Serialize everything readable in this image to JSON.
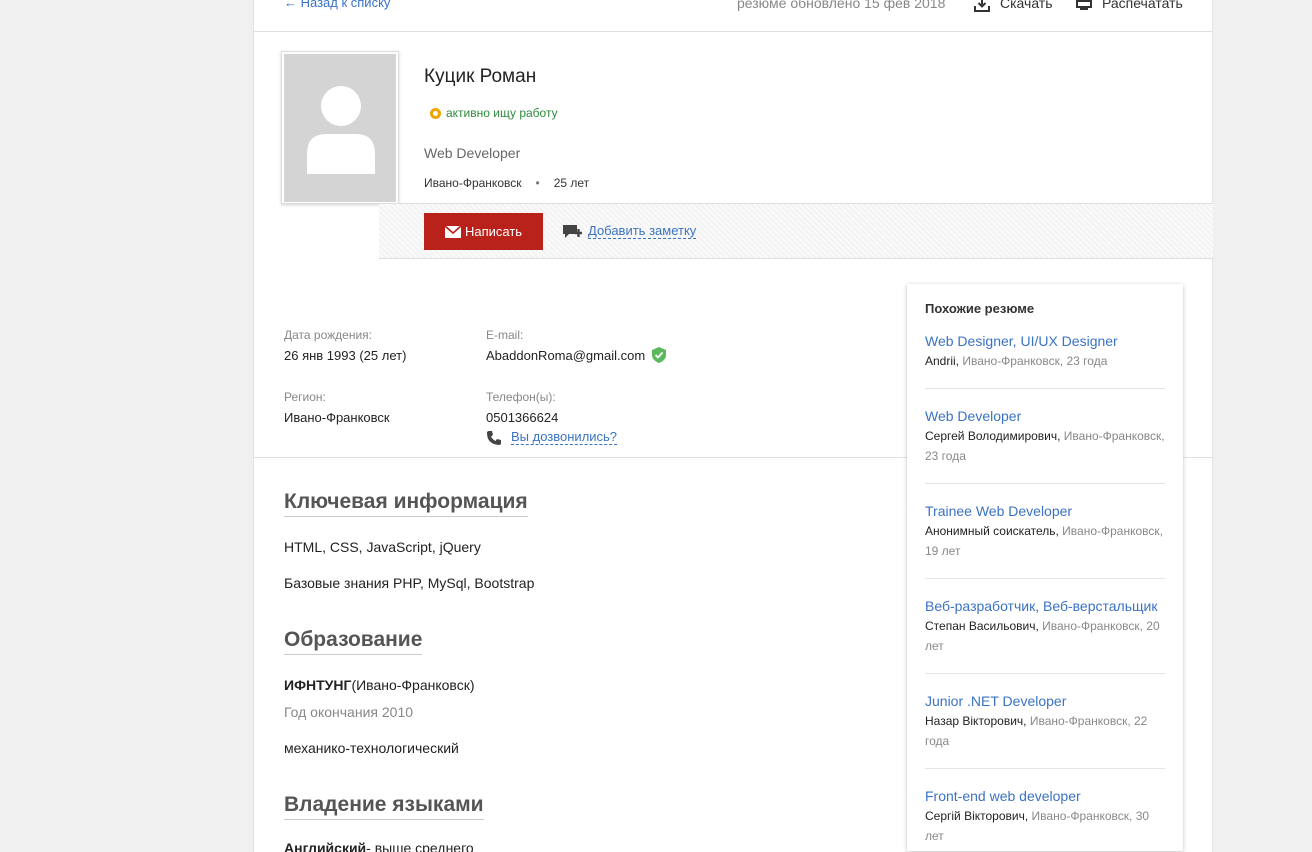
{
  "topbar": {
    "back_label": "← Назад к списку",
    "updated": "резюме обновлено 15 фев 2018",
    "download_label": "Скачать",
    "print_label": "Распечатать"
  },
  "profile": {
    "name": "Куцик Роман",
    "status": "активно ищу работу",
    "position": "Web Developer",
    "city": "Ивано-Франковск",
    "separator": "•",
    "age": "25 лет"
  },
  "actions": {
    "write_label": "Написать",
    "note_label": "Добавить заметку"
  },
  "contacts": {
    "birth_label": "Дата рождения:",
    "birth_value": "26 янв 1993 (25 лет)",
    "region_label": "Регион:",
    "region_value": "Ивано-Франковск",
    "email_label": "E-mail:",
    "email_value": "AbaddonRoma@gmail.com",
    "phone_label": "Телефон(ы):",
    "phone_value": "0501366624",
    "called_label": "Вы дозвонились?"
  },
  "key_info": {
    "title": "Ключевая информация",
    "lines": [
      "HTML, CSS, JavaScript, jQuery",
      "Базовые знания PHP, MySql, Bootstrap"
    ]
  },
  "education": {
    "title": "Образование",
    "school": "ИФНТУНГ",
    "school_city": "(Ивано-Франковск)",
    "year": "Год окончания 2010",
    "faculty": "механико-технологический"
  },
  "languages": {
    "title": "Владение языками",
    "lang": "Английский",
    "level": "- выше среднего"
  },
  "similar": {
    "title": "Похожие резюме",
    "items": [
      {
        "title": "Web Designer, UI/UX Designer",
        "person": "Andrii,",
        "details": " Ивано-Франковск, 23 года"
      },
      {
        "title": "Web Developer",
        "person": "Сергей Володимирович,",
        "details": " Ивано-Франковск, 23 года"
      },
      {
        "title": "Trainee Web Developer",
        "person": "Анонимный соискатель,",
        "details": " Ивано-Франковск, 19 лет"
      },
      {
        "title": "Веб-разработчик, Веб-верстальщик",
        "person": "Степан Васильович,",
        "details": " Ивано-Франковск, 20 лет"
      },
      {
        "title": "Junior .NET Developer",
        "person": "Назар Вікторович,",
        "details": " Ивано-Франковск, 22 года"
      },
      {
        "title": "Front-end web developer",
        "person": "Сергій Вікторович,",
        "details": " Ивано-Франковск, 30 лет"
      }
    ]
  }
}
